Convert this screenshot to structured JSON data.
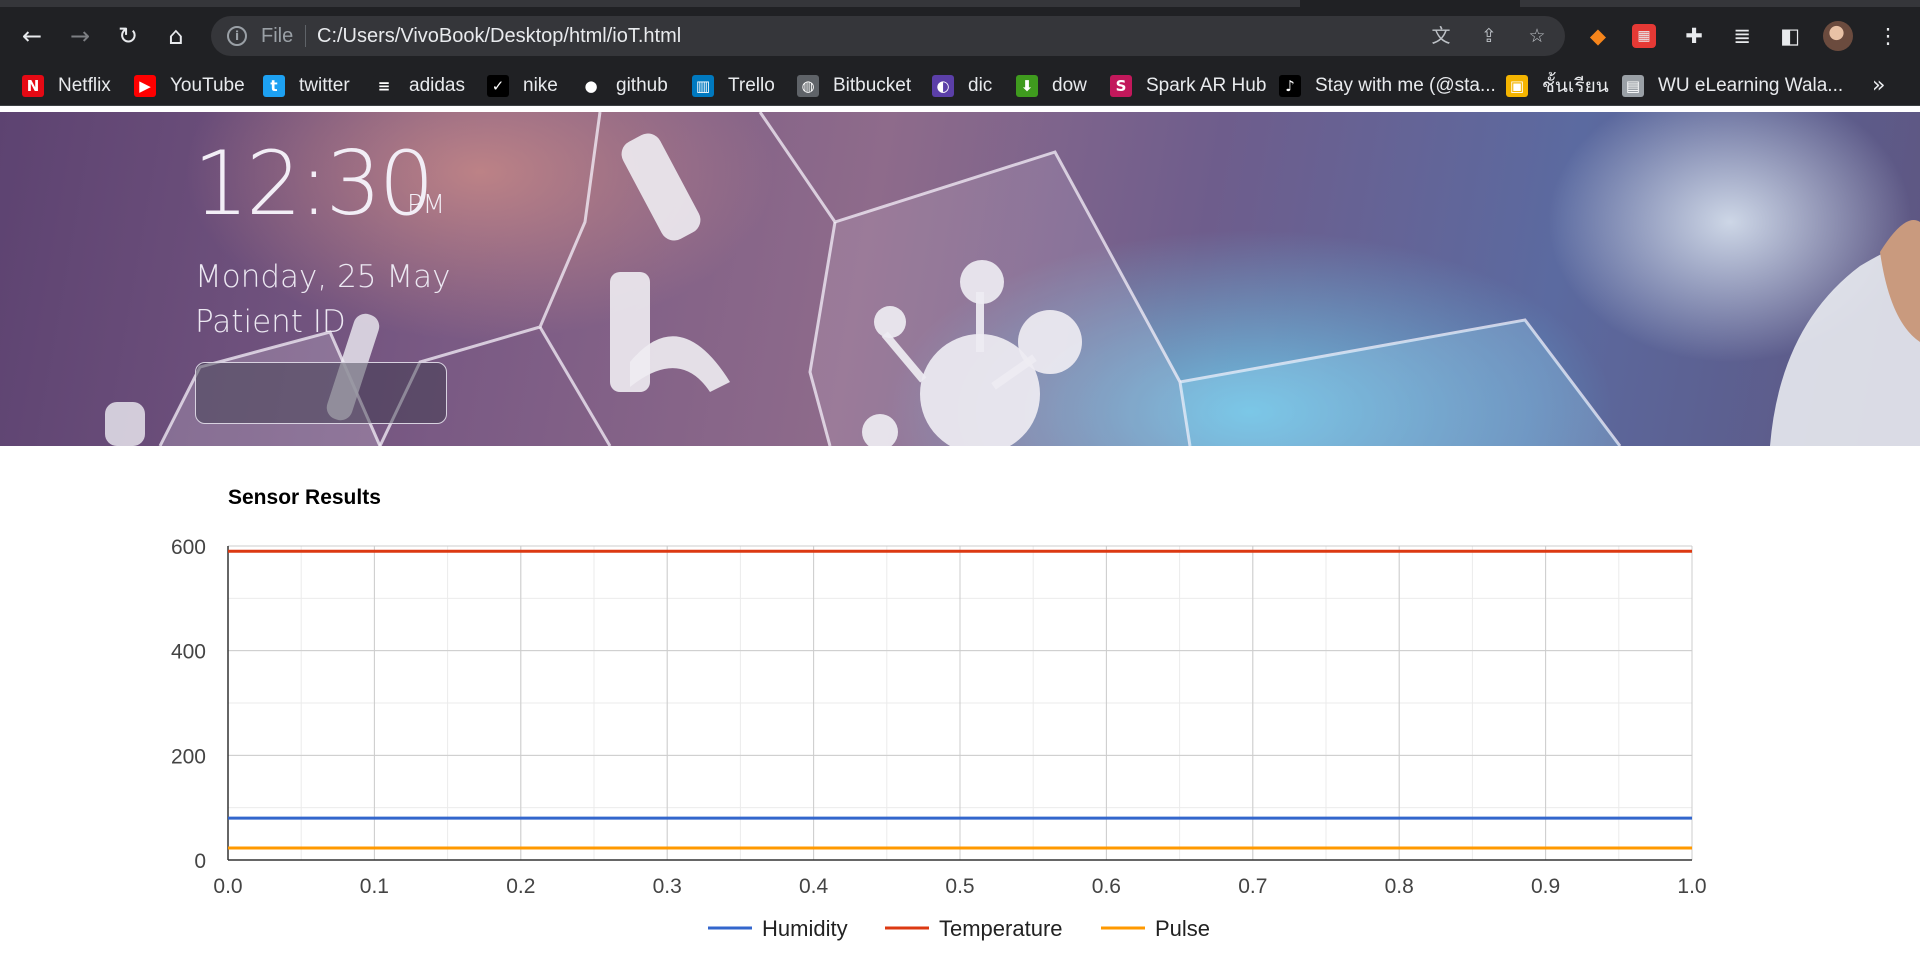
{
  "browser": {
    "address": {
      "scheme": "File",
      "url": "C:/Users/VivoBook/Desktop/html/ioT.html"
    },
    "nav": {
      "back_icon": "back-arrow-icon",
      "forward_icon": "forward-arrow-icon",
      "reload_icon": "reload-icon",
      "home_icon": "home-icon"
    },
    "bookmarks": [
      {
        "label": "Netflix",
        "icon": "netflix-icon",
        "glyph": "N",
        "color": "#e50914"
      },
      {
        "label": "YouTube",
        "icon": "youtube-icon",
        "glyph": "▶",
        "color": "#ff0000"
      },
      {
        "label": "twitter",
        "icon": "twitter-icon",
        "glyph": "t",
        "color": "#1da1f2"
      },
      {
        "label": "adidas",
        "icon": "adidas-icon",
        "glyph": "≡",
        "color": "#202124"
      },
      {
        "label": "nike",
        "icon": "nike-icon",
        "glyph": "✓",
        "color": "#000000"
      },
      {
        "label": "github",
        "icon": "github-icon",
        "glyph": "●",
        "color": "#202124"
      },
      {
        "label": "Trello",
        "icon": "trello-icon",
        "glyph": "▥",
        "color": "#0079bf"
      },
      {
        "label": "Bitbucket",
        "icon": "globe-icon",
        "glyph": "◍",
        "color": "#5f6368"
      },
      {
        "label": "dic",
        "icon": "dic-icon",
        "glyph": "◐",
        "color": "#5b3fa8"
      },
      {
        "label": "dow",
        "icon": "download-icon",
        "glyph": "⬇",
        "color": "#3f9b1e"
      },
      {
        "label": "Spark AR Hub",
        "icon": "spark-ar-icon",
        "glyph": "S",
        "color": "#c2185b"
      },
      {
        "label": "Stay with me (@sta...",
        "icon": "tiktok-icon",
        "glyph": "♪",
        "color": "#000000"
      },
      {
        "label": "ชั้นเรียน",
        "icon": "classroom-icon",
        "glyph": "▣",
        "color": "#f4b400"
      },
      {
        "label": "WU eLearning Wala...",
        "icon": "page-icon",
        "glyph": "▤",
        "color": "#9aa0a6"
      }
    ]
  },
  "hero": {
    "time": "12:30",
    "ampm": "PM",
    "date": "Monday, 25 May",
    "patient_label": "Patient ID",
    "patient_value": ""
  },
  "chart_data": {
    "type": "line",
    "title": "Sensor Results",
    "xlabel": "",
    "ylabel": "",
    "x": [
      0.0,
      1.0
    ],
    "xlim": [
      0.0,
      1.0
    ],
    "ylim": [
      0,
      600
    ],
    "xticks": [
      "0.0",
      "0.1",
      "0.2",
      "0.3",
      "0.4",
      "0.5",
      "0.6",
      "0.7",
      "0.8",
      "0.9",
      "1.0"
    ],
    "yticks": [
      "0",
      "200",
      "400",
      "600"
    ],
    "grid": true,
    "legend": "bottom",
    "series": [
      {
        "name": "Humidity",
        "values": [
          80,
          80
        ],
        "color": "#3366cc"
      },
      {
        "name": "Temperature",
        "values": [
          590,
          590
        ],
        "color": "#dc3912"
      },
      {
        "name": "Pulse",
        "values": [
          23,
          23
        ],
        "color": "#ff9900"
      }
    ]
  }
}
